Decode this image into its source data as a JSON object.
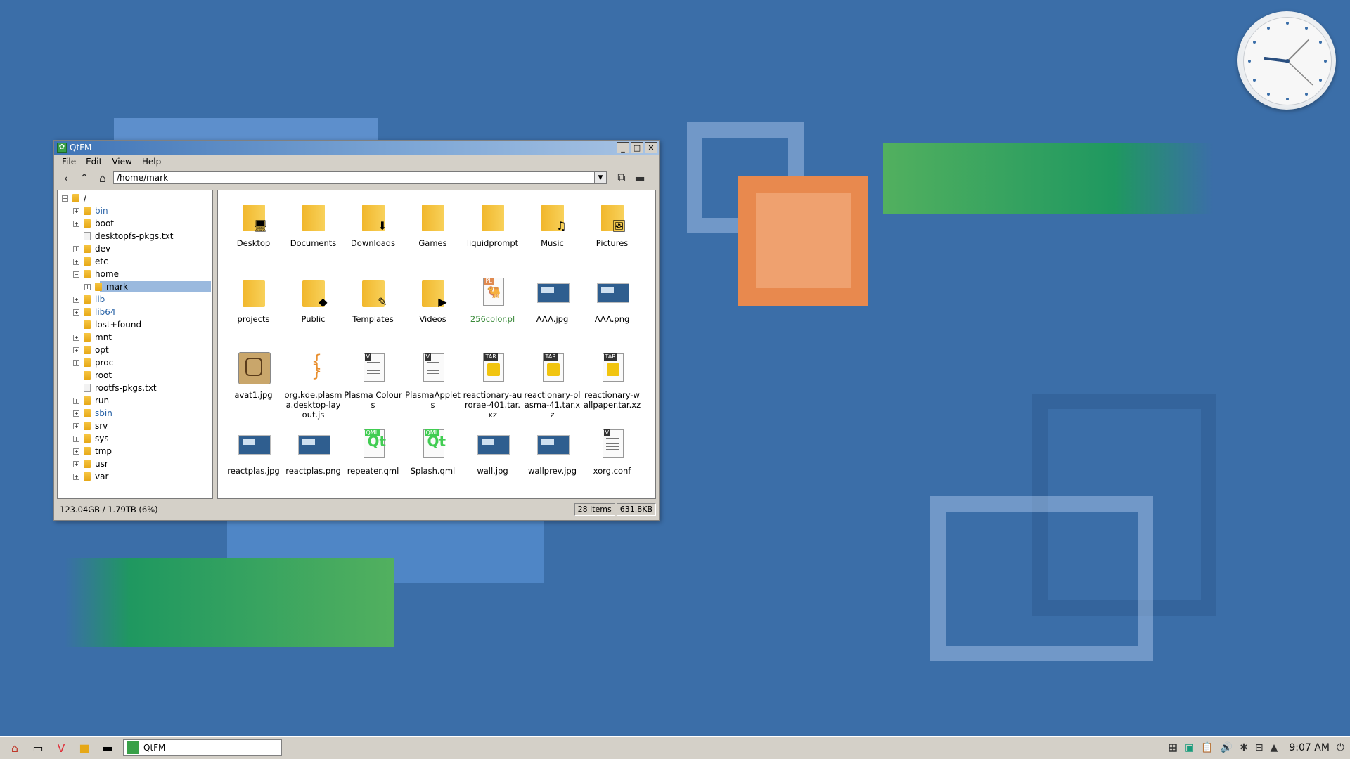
{
  "window": {
    "title": "QtFM",
    "menu": [
      "File",
      "Edit",
      "View",
      "Help"
    ],
    "path": "/home/mark"
  },
  "tree": [
    {
      "label": "/",
      "icon": "folder-icon"
    },
    {
      "label": "bin",
      "link": true
    },
    {
      "label": "boot"
    },
    {
      "label": "desktopfs-pkgs.txt",
      "file": true
    },
    {
      "label": "dev"
    },
    {
      "label": "etc"
    },
    {
      "label": "home"
    },
    {
      "label": "mark",
      "selected": true
    },
    {
      "label": "lib",
      "link": true
    },
    {
      "label": "lib64",
      "link": true
    },
    {
      "label": "lost+found"
    },
    {
      "label": "mnt"
    },
    {
      "label": "opt"
    },
    {
      "label": "proc"
    },
    {
      "label": "root"
    },
    {
      "label": "rootfs-pkgs.txt",
      "file": true
    },
    {
      "label": "run"
    },
    {
      "label": "sbin",
      "link": true
    },
    {
      "label": "srv"
    },
    {
      "label": "sys"
    },
    {
      "label": "tmp"
    },
    {
      "label": "usr"
    },
    {
      "label": "var"
    }
  ],
  "files": [
    {
      "name": "Desktop",
      "type": "folder",
      "icon": "desktop-folder-icon"
    },
    {
      "name": "Documents",
      "type": "folder",
      "icon": "documents-folder-icon"
    },
    {
      "name": "Downloads",
      "type": "folder",
      "icon": "downloads-folder-icon"
    },
    {
      "name": "Games",
      "type": "folder",
      "icon": "folder-icon"
    },
    {
      "name": "liquidprompt",
      "type": "folder",
      "icon": "folder-icon"
    },
    {
      "name": "Music",
      "type": "folder",
      "icon": "music-folder-icon"
    },
    {
      "name": "Pictures",
      "type": "folder",
      "icon": "pictures-folder-icon"
    },
    {
      "name": "projects",
      "type": "folder",
      "icon": "folder-icon"
    },
    {
      "name": "Public",
      "type": "folder",
      "icon": "public-folder-icon"
    },
    {
      "name": "Templates",
      "type": "folder",
      "icon": "templates-folder-icon"
    },
    {
      "name": "Videos",
      "type": "folder",
      "icon": "videos-folder-icon"
    },
    {
      "name": "256color.pl",
      "type": "perl",
      "icon": "perl-file-icon"
    },
    {
      "name": "AAA.jpg",
      "type": "image",
      "icon": "image-file-icon"
    },
    {
      "name": "AAA.png",
      "type": "image",
      "icon": "image-file-icon"
    },
    {
      "name": "avat1.jpg",
      "type": "avatar",
      "icon": "avatar-image-icon"
    },
    {
      "name": "org.kde.plasma.desktop-layout.js",
      "type": "js",
      "icon": "javascript-file-icon"
    },
    {
      "name": "Plasma Colours",
      "type": "doc",
      "icon": "text-file-icon"
    },
    {
      "name": "PlasmaApplets",
      "type": "doc",
      "icon": "text-file-icon"
    },
    {
      "name": "reactionary-aurorae-401.tar.xz",
      "type": "tar",
      "icon": "archive-file-icon"
    },
    {
      "name": "reactionary-plasma-41.tar.xz",
      "type": "tar",
      "icon": "archive-file-icon"
    },
    {
      "name": "reactionary-wallpaper.tar.xz",
      "type": "tar",
      "icon": "archive-file-icon"
    },
    {
      "name": "reactplas.jpg",
      "type": "image",
      "icon": "image-file-icon"
    },
    {
      "name": "reactplas.png",
      "type": "image",
      "icon": "image-file-icon"
    },
    {
      "name": "repeater.qml",
      "type": "qml",
      "icon": "qml-file-icon"
    },
    {
      "name": "Splash.qml",
      "type": "qml",
      "icon": "qml-file-icon"
    },
    {
      "name": "wall.jpg",
      "type": "image",
      "icon": "image-file-icon"
    },
    {
      "name": "wallprev.jpg",
      "type": "image",
      "icon": "image-file-icon"
    },
    {
      "name": "xorg.conf",
      "type": "doc",
      "icon": "text-file-icon"
    }
  ],
  "status": {
    "disk": "123.04GB  /  1.79TB  (6%)",
    "items": "28 items",
    "size": "631.8KB"
  },
  "taskbar": {
    "task_label": "QtFM",
    "time": "9:07 AM"
  },
  "colors": {
    "desktop": "#3b6ea8",
    "selection": "#9ab9de",
    "titlebar": "#3f74b6"
  }
}
